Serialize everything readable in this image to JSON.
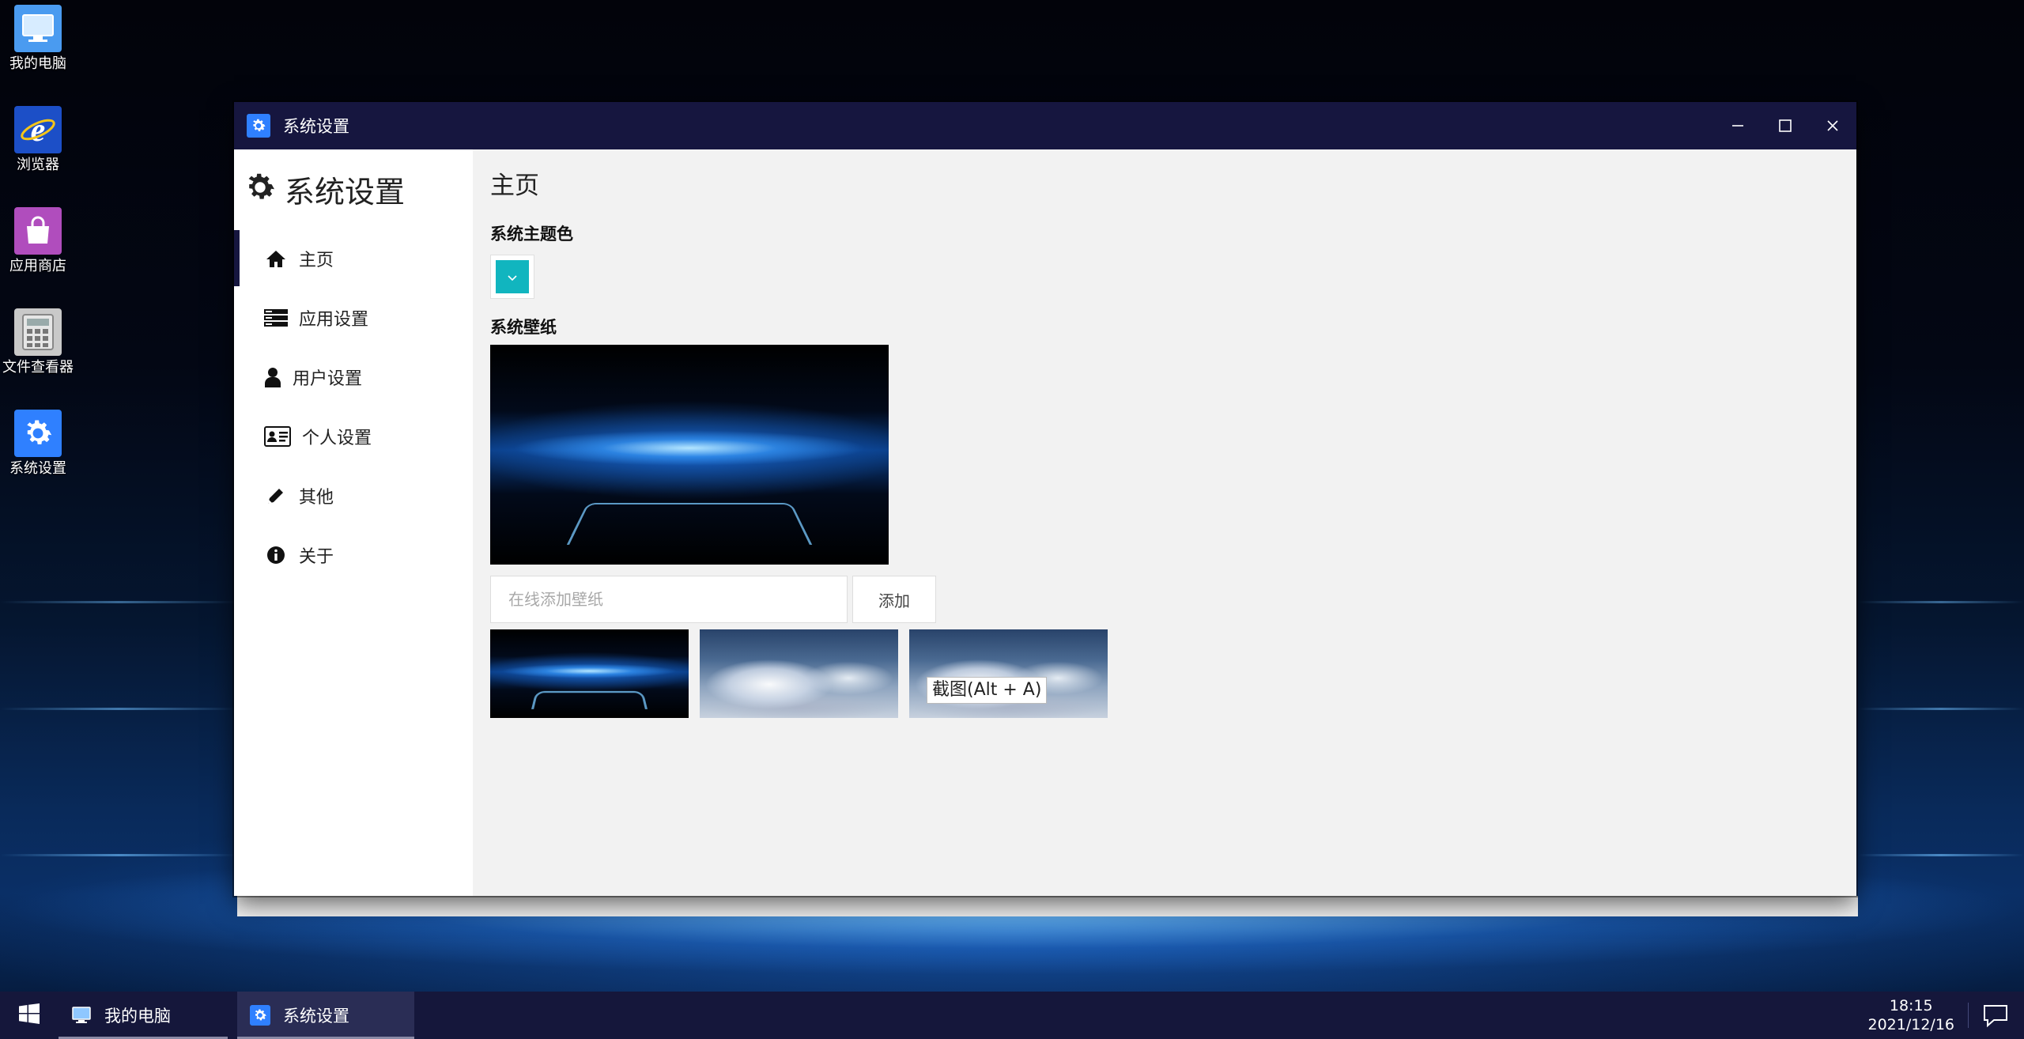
{
  "desktop": {
    "icons": [
      {
        "label": "我的电脑",
        "icon": "computer-icon"
      },
      {
        "label": "浏览器",
        "icon": "browser-icon"
      },
      {
        "label": "应用商店",
        "icon": "store-icon"
      },
      {
        "label": "文件查看器",
        "icon": "calculator-icon"
      },
      {
        "label": "系统设置",
        "icon": "gear-icon"
      }
    ]
  },
  "window": {
    "title": "系统设置",
    "controls": {
      "minimize": "—",
      "maximize": "☐",
      "close": "✕"
    }
  },
  "sidebar": {
    "title": "系统设置",
    "items": [
      {
        "label": "主页",
        "icon": "home-icon",
        "active": true
      },
      {
        "label": "应用设置",
        "icon": "list-icon",
        "active": false
      },
      {
        "label": "用户设置",
        "icon": "user-icon",
        "active": false
      },
      {
        "label": "个人设置",
        "icon": "id-card-icon",
        "active": false
      },
      {
        "label": "其他",
        "icon": "pencil-icon",
        "active": false
      },
      {
        "label": "关于",
        "icon": "info-icon",
        "active": false
      }
    ]
  },
  "main": {
    "page_title": "主页",
    "theme_label": "系统主题色",
    "theme_color": "#11b5bf",
    "wallpaper_label": "系统壁纸",
    "wallpaper_input_placeholder": "在线添加壁纸",
    "add_button": "添加",
    "thumbnails": [
      "blue-light-tunnel",
      "snowy-mountain",
      "snowy-mountain"
    ],
    "tooltip": "截图(Alt + A)"
  },
  "taskbar": {
    "tasks": [
      {
        "label": "我的电脑",
        "icon": "computer-icon"
      },
      {
        "label": "系统设置",
        "icon": "gear-icon"
      }
    ],
    "time": "18:15",
    "date": "2021/12/16"
  },
  "colors": {
    "accent": "#16163f",
    "taskbar": "#15173b",
    "theme": "#11b5bf"
  }
}
